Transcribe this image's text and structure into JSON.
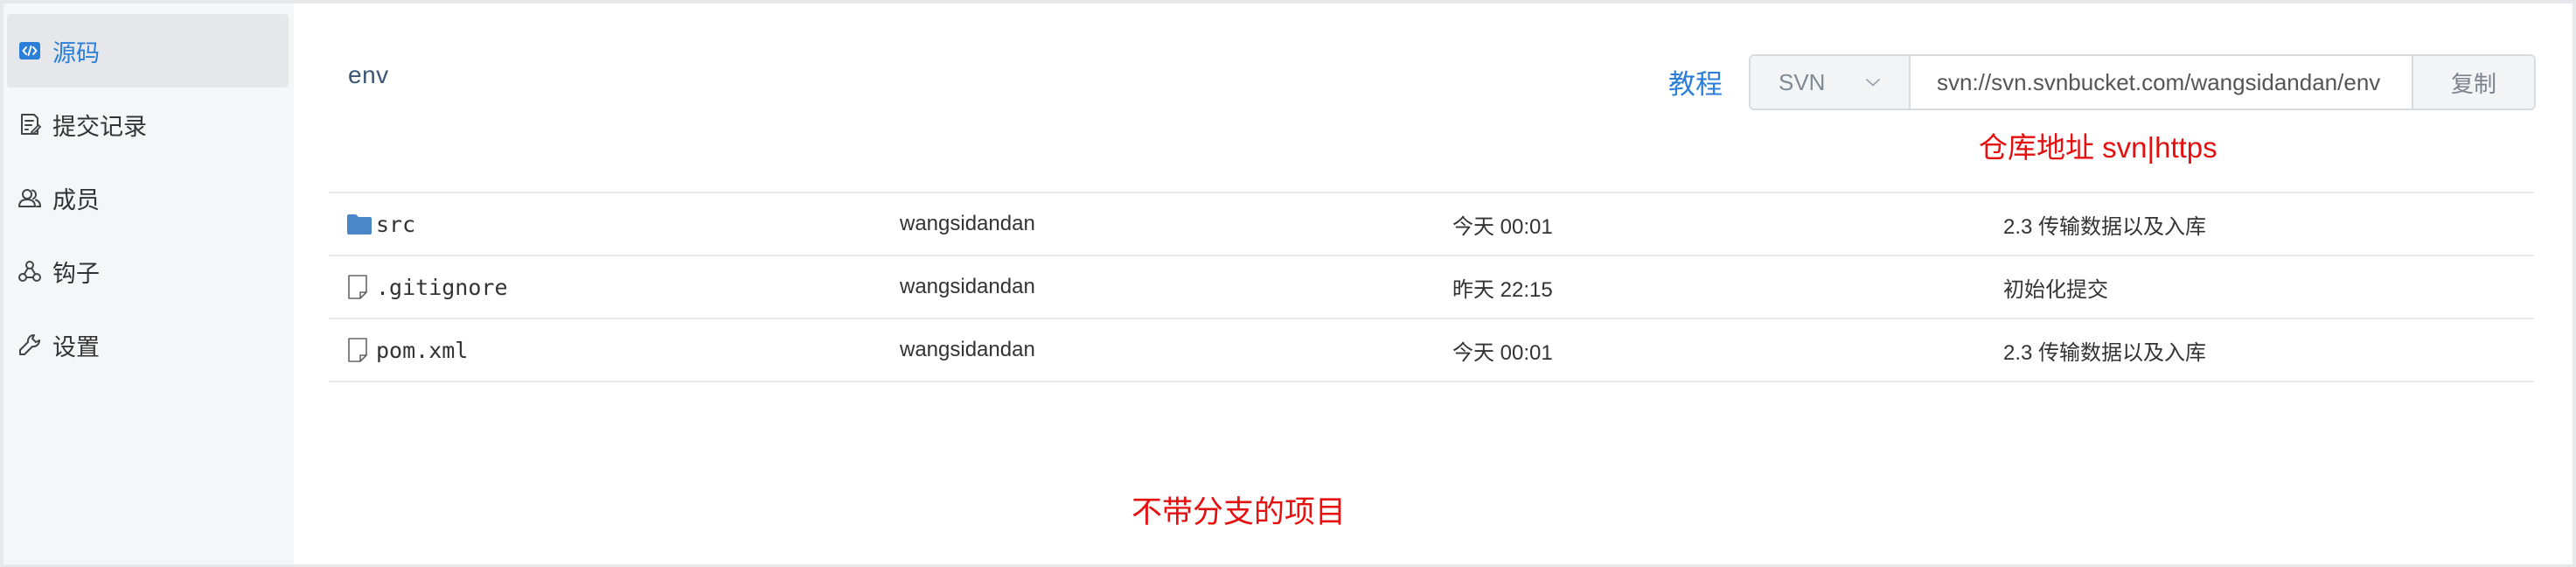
{
  "sidebar": {
    "items": [
      {
        "label": "源码",
        "icon": "code-icon",
        "active": true
      },
      {
        "label": "提交记录",
        "icon": "commit-log-icon",
        "active": false
      },
      {
        "label": "成员",
        "icon": "members-icon",
        "active": false
      },
      {
        "label": "钩子",
        "icon": "webhook-icon",
        "active": false
      },
      {
        "label": "设置",
        "icon": "settings-icon",
        "active": false
      }
    ]
  },
  "header": {
    "path": "env",
    "tutorial_link": "教程",
    "protocol": "SVN",
    "repo_url": "svn://svn.svnbucket.com/wangsidandan/env",
    "copy_label": "复制"
  },
  "annotations": {
    "repo_address": "仓库地址 svn|https",
    "no_branch": "不带分支的项目"
  },
  "files": [
    {
      "name": "src",
      "type": "folder",
      "author": "wangsidandan",
      "time": "今天 00:01",
      "message": "2.3 传输数据以及入库"
    },
    {
      "name": ".gitignore",
      "type": "file",
      "author": "wangsidandan",
      "time": "昨天 22:15",
      "message": "初始化提交"
    },
    {
      "name": "pom.xml",
      "type": "file",
      "author": "wangsidandan",
      "time": "今天 00:01",
      "message": "2.3 传输数据以及入库"
    }
  ],
  "colors": {
    "accent": "#2b7fd8",
    "annotation": "#e50f10",
    "sidebar_bg": "#f5f6f7",
    "folder": "#4a86c8"
  }
}
